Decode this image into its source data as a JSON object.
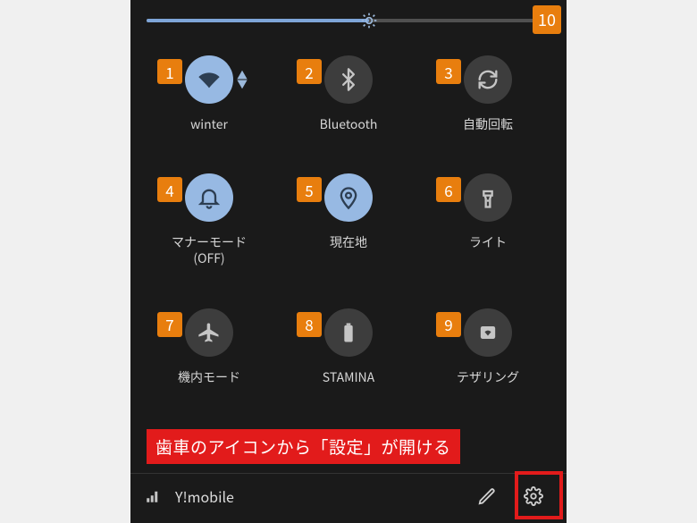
{
  "brightness_badge": "10",
  "tiles": [
    {
      "num": "1",
      "label": "winter",
      "icon": "wifi",
      "active": true,
      "arrows": true
    },
    {
      "num": "2",
      "label": "Bluetooth",
      "icon": "bluetooth",
      "active": false
    },
    {
      "num": "3",
      "label": "自動回転",
      "icon": "rotate",
      "active": false
    },
    {
      "num": "4",
      "label": "マナーモード\n(OFF)",
      "icon": "bell",
      "active": true
    },
    {
      "num": "5",
      "label": "現在地",
      "icon": "location",
      "active": true
    },
    {
      "num": "6",
      "label": "ライト",
      "icon": "flashlight",
      "active": false
    },
    {
      "num": "7",
      "label": "機内モード",
      "icon": "airplane",
      "active": false
    },
    {
      "num": "8",
      "label": "STAMINA",
      "icon": "battery",
      "active": false
    },
    {
      "num": "9",
      "label": "テザリング",
      "icon": "hotspot",
      "active": false
    }
  ],
  "callout_text": "歯車のアイコンから「設定」が開ける",
  "carrier": "Y!mobile",
  "colors": {
    "badge": "#e87e0e",
    "callout": "#e21b1b",
    "tile_active": "#97b9e3",
    "tile_inactive": "#3d3d3d"
  }
}
